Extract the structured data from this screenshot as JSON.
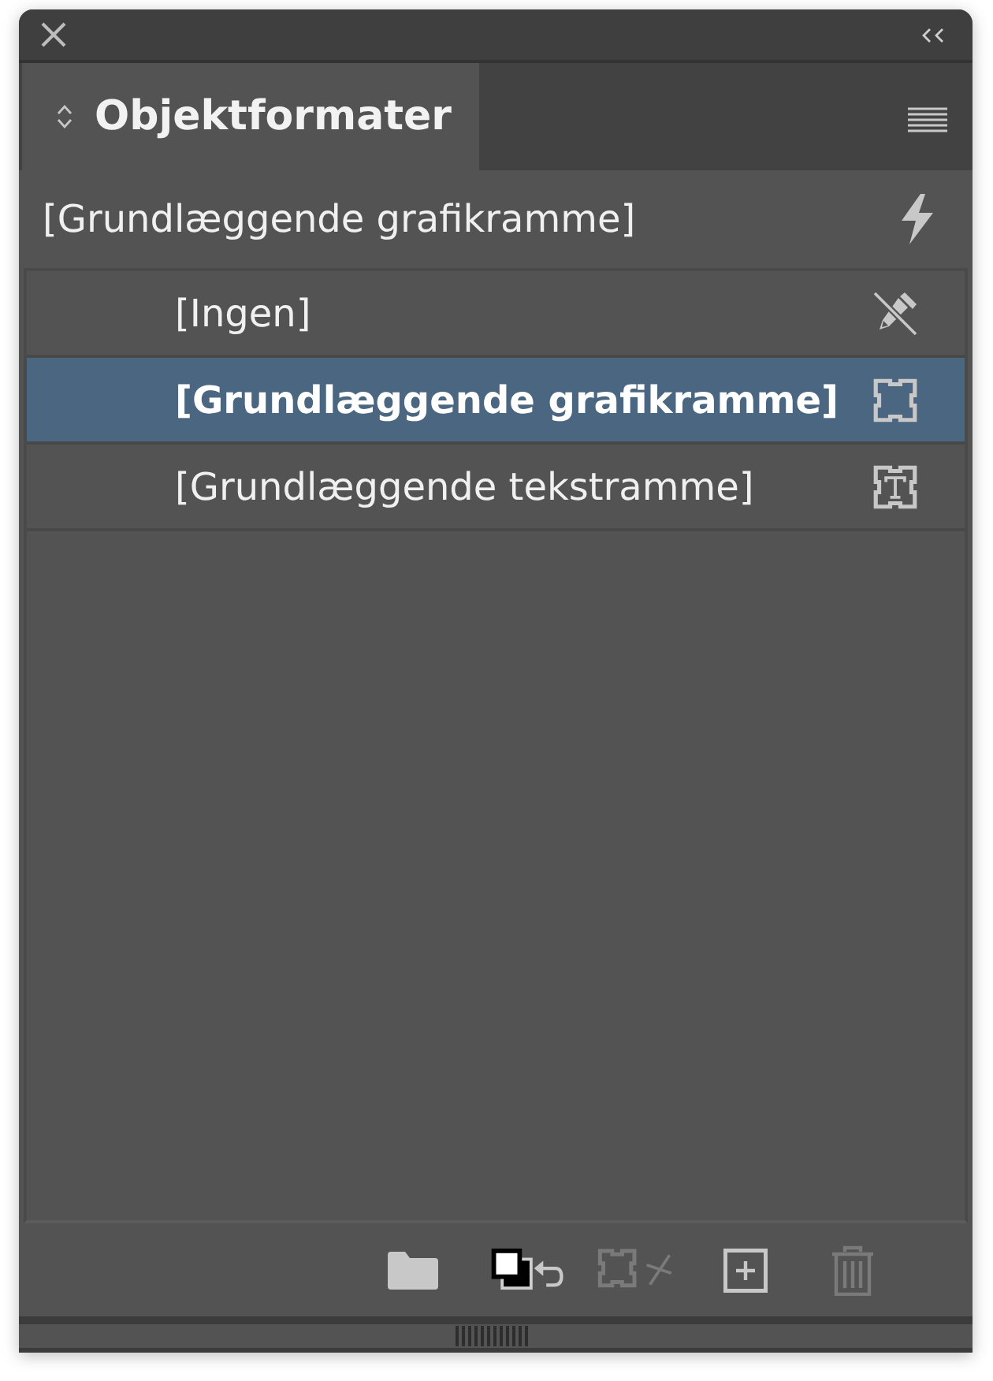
{
  "tabs": [
    {
      "label": "Objektformater",
      "selected": true
    }
  ],
  "current_style": "[Grundlæggende grafikramme]",
  "styles": [
    {
      "name": "[Ingen]",
      "kind": "none",
      "selected": false
    },
    {
      "name": "[Grundlæggende grafikramme]",
      "kind": "graphic",
      "selected": true
    },
    {
      "name": "[Grundlæggende tekstramme]",
      "kind": "text",
      "selected": false
    }
  ],
  "footer_buttons": [
    {
      "kind": "folder",
      "disabled": false
    },
    {
      "kind": "clear-attributes",
      "disabled": false
    },
    {
      "kind": "clear-overrides",
      "disabled": true
    },
    {
      "kind": "new",
      "disabled": false
    },
    {
      "kind": "delete",
      "disabled": true
    }
  ]
}
